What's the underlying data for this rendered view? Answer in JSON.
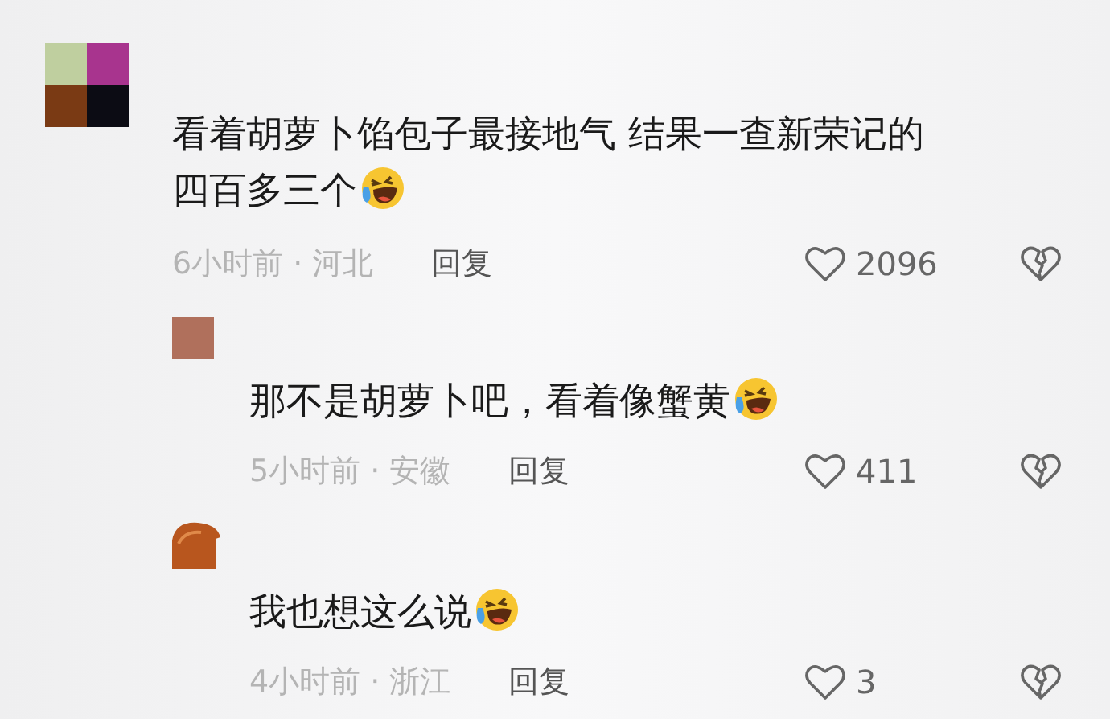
{
  "comments": [
    {
      "avatar": {
        "kind": "tiles"
      },
      "lines": [
        "看着胡萝卜馅包子最接地气 结果一查新荣记的",
        "四百多三个"
      ],
      "emoji": true,
      "meta": "6小时前 · 河北",
      "reply": "回复",
      "likes": "2096",
      "replies": [
        {
          "avatar": {
            "kind": "square"
          },
          "lines": [
            "那不是胡萝卜吧，看着像蟹黄"
          ],
          "emoji": true,
          "meta": "5小时前 · 安徽",
          "reply": "回复",
          "likes": "411"
        },
        {
          "avatar": {
            "kind": "round"
          },
          "lines": [
            "我也想这么说"
          ],
          "emoji": true,
          "meta": "4小时前 · 浙江",
          "reply": "回复",
          "likes": "3"
        }
      ]
    }
  ]
}
